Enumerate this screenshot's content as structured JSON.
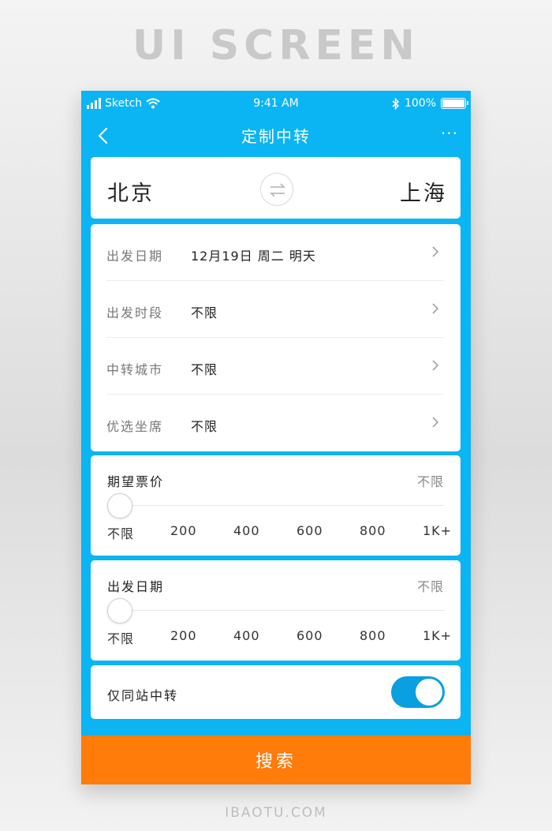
{
  "banner": {
    "title": "UI SCREEN",
    "footer": "IBAOTU.COM"
  },
  "status_bar": {
    "carrier": "Sketch",
    "time": "9:41 AM",
    "battery": "100%",
    "battery_level": 1.0
  },
  "nav": {
    "title": "定制中转",
    "back_icon": "chevron-left-icon",
    "more_icon": "more-dots-icon",
    "more_label": "···"
  },
  "route": {
    "from": "北京",
    "to": "上海",
    "swap_icon": "swap-arrows-icon"
  },
  "options": [
    {
      "label": "出发日期",
      "value": "12月19日 周二 明天"
    },
    {
      "label": "出发时段",
      "value": "不限"
    },
    {
      "label": "中转城市",
      "value": "不限"
    },
    {
      "label": "优选坐席",
      "value": "不限"
    }
  ],
  "price_slider": {
    "title": "期望票价",
    "value": "不限",
    "level": 0,
    "ticks": [
      "不限",
      "200",
      "400",
      "600",
      "800",
      "1K+"
    ]
  },
  "date_slider": {
    "title": "出发日期",
    "value": "不限",
    "level": 0,
    "ticks": [
      "不限",
      "200",
      "400",
      "600",
      "800",
      "1K+"
    ]
  },
  "same_station": {
    "label": "仅同站中转",
    "enabled": true
  },
  "search": {
    "label": "搜索"
  },
  "colors": {
    "primary": "#0bb4f3",
    "accent": "#ff7b0a",
    "switch_on": "#0a9fe0"
  }
}
